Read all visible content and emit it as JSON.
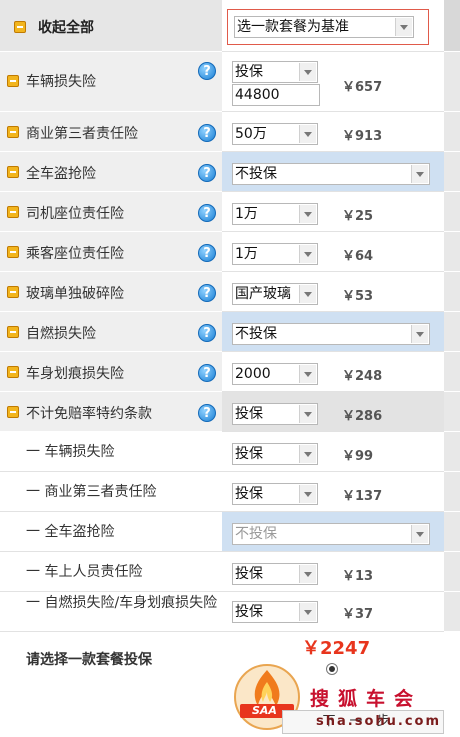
{
  "header": {
    "collapse_all_label": "收起全部",
    "package_select": "选一款套餐为基准"
  },
  "rows": [
    {
      "label": "车辆损失险",
      "select": "投保",
      "input": "44800",
      "price": "￥657"
    },
    {
      "label": "商业第三者责任险",
      "select": "50万",
      "price": "￥913"
    },
    {
      "label": "全车盗抢险",
      "select": "不投保"
    },
    {
      "label": "司机座位责任险",
      "select": "1万",
      "price": "￥25"
    },
    {
      "label": "乘客座位责任险",
      "select": "1万",
      "price": "￥64"
    },
    {
      "label": "玻璃单独破碎险",
      "select": "国产玻璃",
      "price": "￥53"
    },
    {
      "label": "自燃损失险",
      "select": "不投保"
    },
    {
      "label": "车身划痕损失险",
      "select": "2000",
      "price": "￥248"
    },
    {
      "label": "不计免赔率特约条款",
      "select": "投保",
      "price": "￥286"
    }
  ],
  "subrows": [
    {
      "label": "一  车辆损失险",
      "select": "投保",
      "price": "￥99"
    },
    {
      "label": "一  商业第三者责任险",
      "select": "投保",
      "price": "￥137"
    },
    {
      "label": "一  全车盗抢险",
      "select": "不投保"
    },
    {
      "label": "一  车上人员责任险",
      "select": "投保",
      "price": "￥13"
    },
    {
      "label": "一  自燃损失险/车身划痕损失险",
      "select": "投保",
      "price": "￥37"
    }
  ],
  "footer": {
    "prompt": "请选择一款套餐投保",
    "total": "￥2247",
    "next_button": "下一步",
    "watermark": "搜狐车会",
    "watermark_url": "sha.sohu.com",
    "logo_text": "SAA"
  },
  "colors": {
    "total_red": "#e8351d",
    "watermark_red": "#c8102e",
    "select_blue_bg": "#cfe0f2"
  }
}
